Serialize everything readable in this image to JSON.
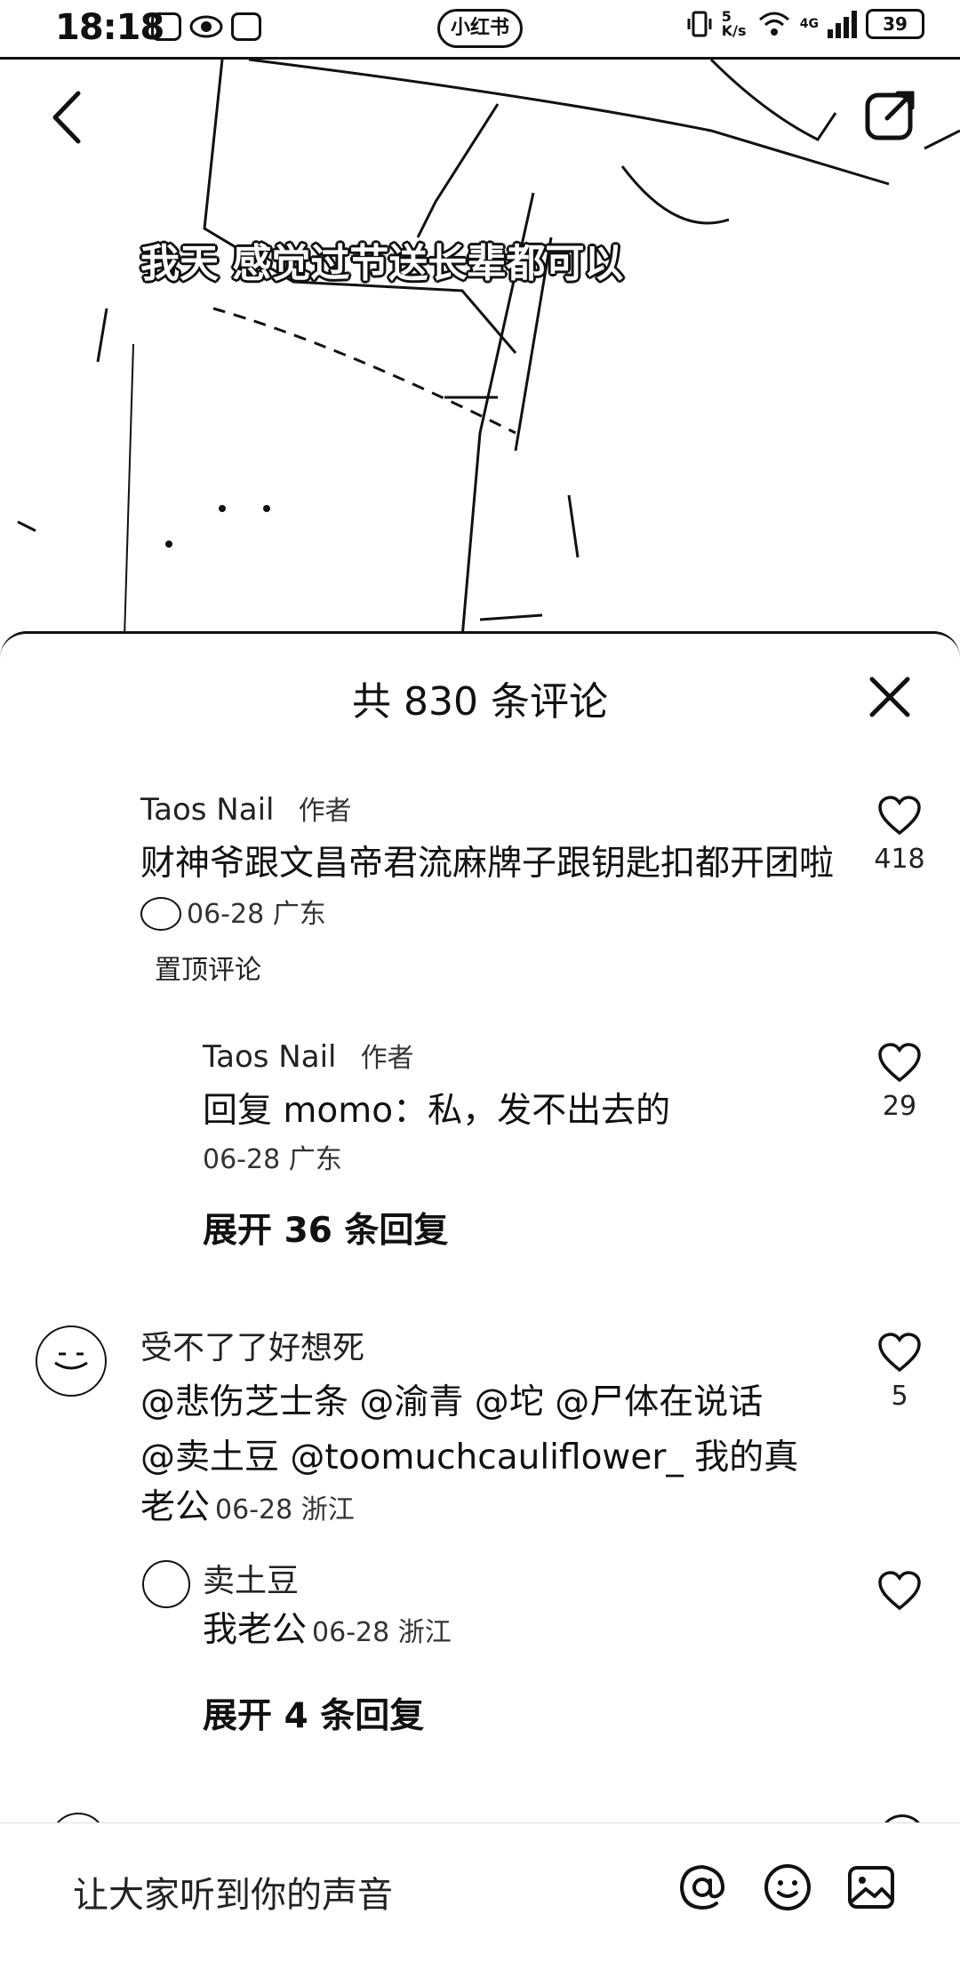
{
  "status_bar": {
    "time": "18:18",
    "center_pill": "小红书",
    "net_speed": "5 K/s",
    "network": "4G",
    "battery": "39"
  },
  "video": {
    "caption": "我天 感觉过节送长辈都可以"
  },
  "comments_sheet": {
    "title": "共 830 条评论",
    "comments": [
      {
        "author": "Taos Nail",
        "tag": "作者",
        "text": "财神爷跟文昌帝君流麻牌子跟钥匙扣都开团啦",
        "date": "06-28 广东",
        "pinned_label": "置顶评论",
        "likes": "418"
      },
      {
        "author": "Taos Nail",
        "tag": "作者",
        "text": "回复  momo：私，发不出去的",
        "date": "06-28 广东",
        "likes": "29"
      },
      {
        "expand_label": "展开 36 条回复"
      },
      {
        "author": "受不了了好想死",
        "text_line1": "@悲伤芝士条  @渝青  @坨  @尸体在说话",
        "text_line2": "@卖土豆  @toomuchcauliflower_  我的真",
        "text_line3": "老公",
        "date": "06-28 浙江",
        "likes": "5"
      },
      {
        "author": "卖土豆",
        "text": "我老公",
        "date": "06-28 浙江"
      },
      {
        "expand_label": "展开 4 条回复"
      }
    ]
  },
  "input_bar": {
    "placeholder": "让大家听到你的声音",
    "icons": [
      "at-icon",
      "emoji-icon",
      "image-icon"
    ]
  }
}
